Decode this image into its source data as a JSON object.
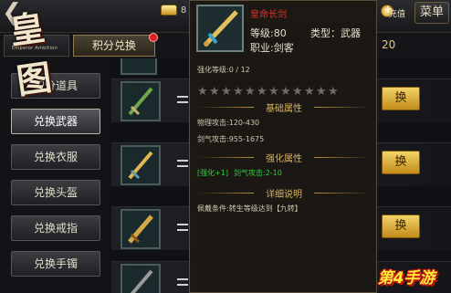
{
  "header": {
    "back_glyph": "❮",
    "logo_text": "皇图",
    "logo_sub": "Emperor Ambition",
    "gold_amount": "8",
    "charge_label": "充值",
    "menu_label": "菜单"
  },
  "tabs": {
    "active_label": "积分兑换",
    "right_value": "20"
  },
  "sidebar": {
    "items": [
      {
        "label": "积分道具",
        "active": false
      },
      {
        "label": "兑换武器",
        "active": true
      },
      {
        "label": "兑换衣服",
        "active": false
      },
      {
        "label": "兑换头盔",
        "active": false
      },
      {
        "label": "兑换戒指",
        "active": false
      },
      {
        "label": "兑换手镯",
        "active": false
      }
    ]
  },
  "list": {
    "swap_label": "换",
    "rows": [
      {
        "icon": "jade-sword-icon",
        "color": "#4e8a3a"
      },
      {
        "icon": "dragon-sword-icon",
        "color": "#d7a440"
      },
      {
        "icon": "golden-blade-icon",
        "color": "#c9a038"
      },
      {
        "icon": "sword-icon",
        "color": "#7a7a7a"
      }
    ]
  },
  "tooltip": {
    "name": "皇命长剑",
    "level": "等级:80",
    "type": "类型：武器",
    "career": "职业:剑客",
    "enhance": "强化等级:0 / 12",
    "stars_total": 12,
    "basic_header": "基础属性",
    "phys_attack": "物理攻击:120-430",
    "sword_attack": "剑气攻击:955-1675",
    "enhance_header": "强化属性",
    "enhance_tag": "[强化+1]",
    "enhance_value": "剑气攻击:2-10",
    "detail_header": "详细说明",
    "wear_condition": "佩戴条件:转生等级达到【九转】"
  },
  "watermark": {
    "text": "第4手游"
  },
  "colors": {
    "accent_gold": "#d7b35a",
    "item_name_red": "#e0302a",
    "enhance_green": "#2ed13a"
  }
}
